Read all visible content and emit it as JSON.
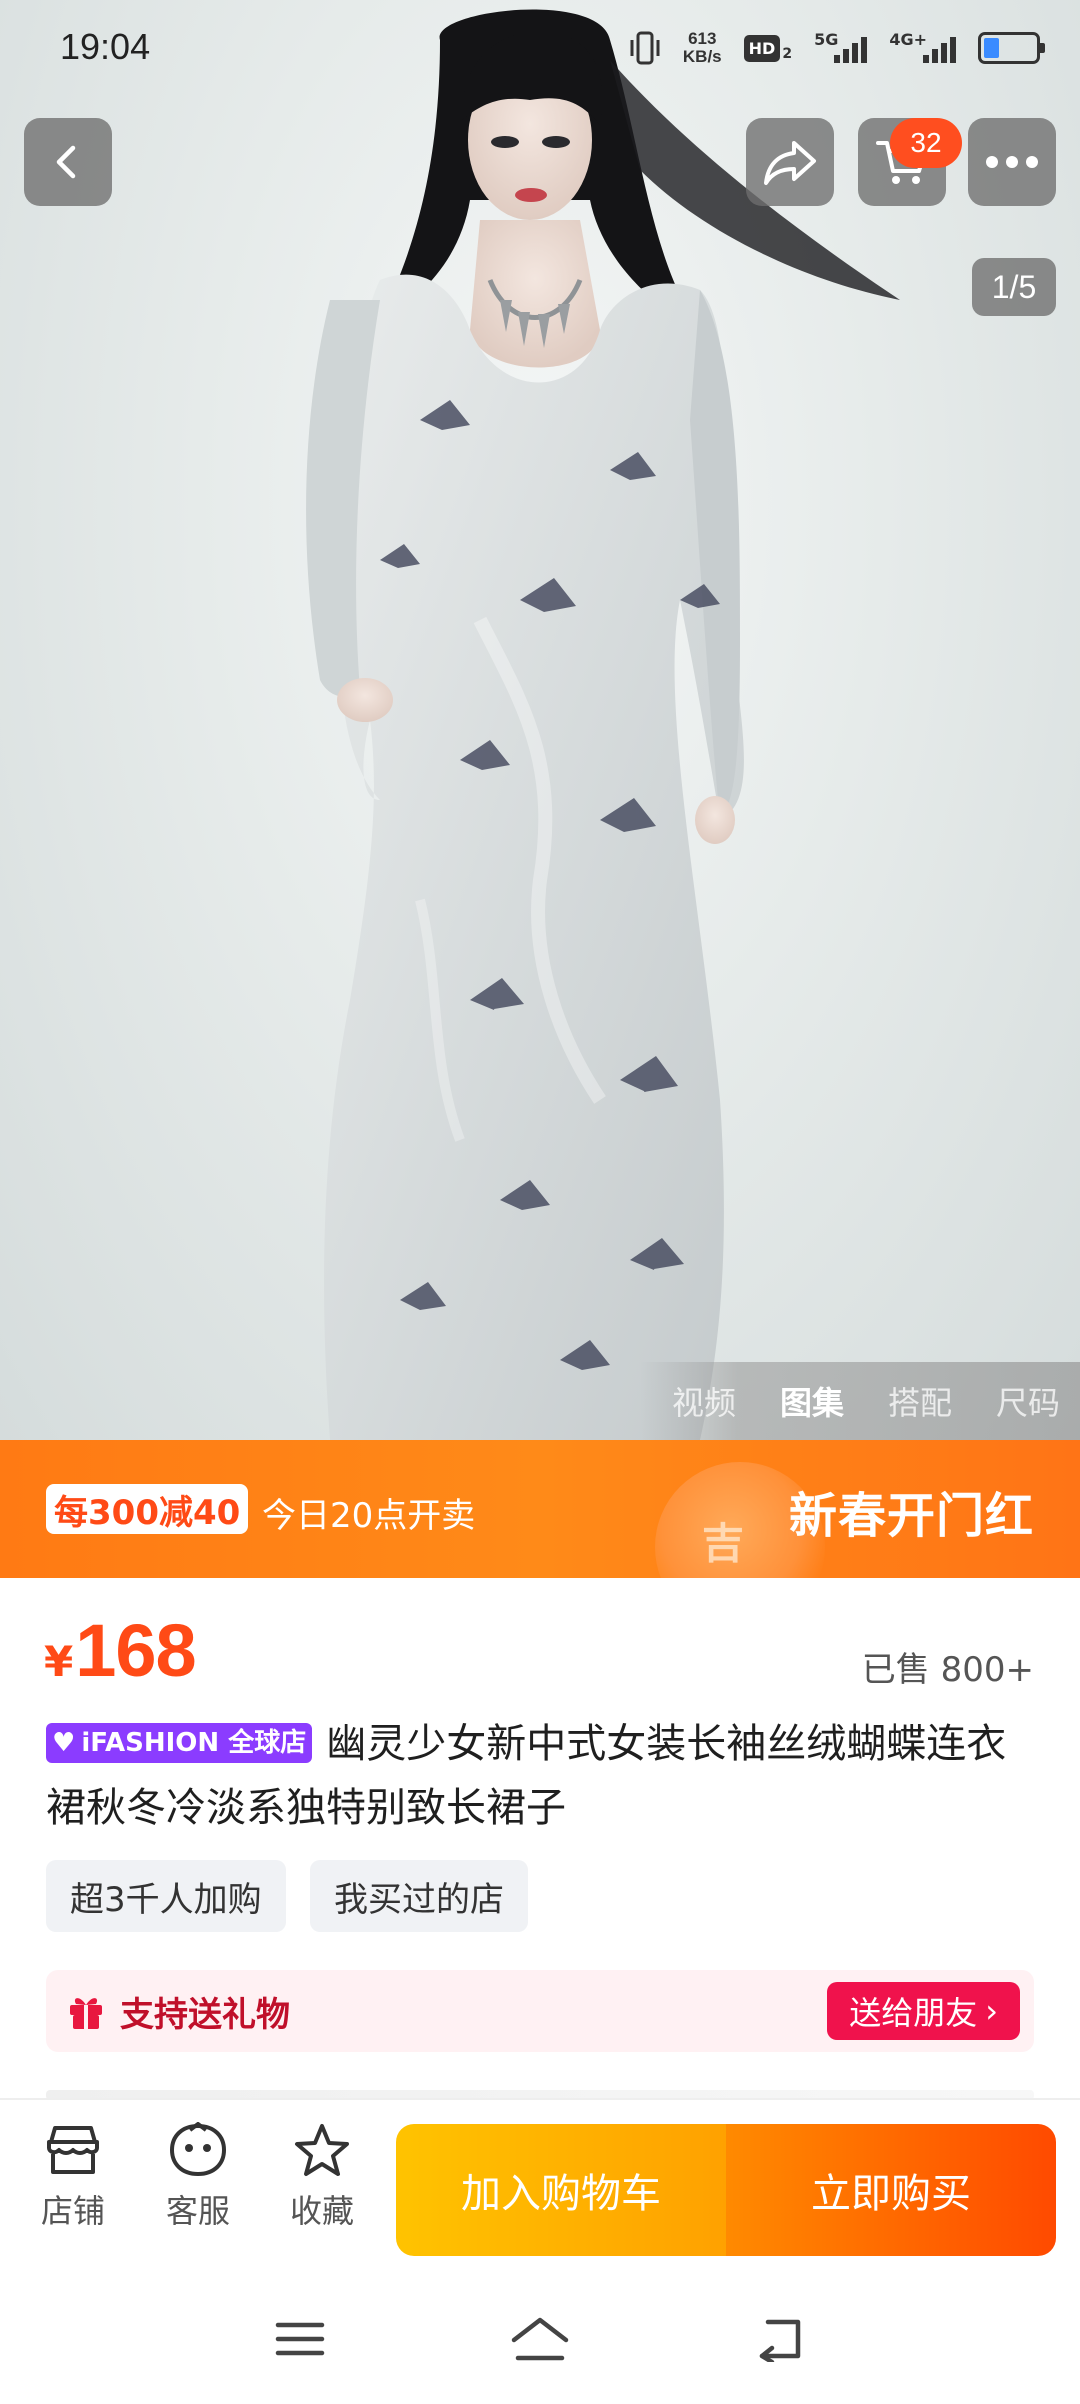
{
  "status_bar": {
    "time": "19:04",
    "net_speed_value": "613",
    "net_speed_unit": "KB/s",
    "hd_label": "HD",
    "hd_sub": "2",
    "sig1_label": "5G",
    "sig2_label": "4G+",
    "battery_level": 0.3
  },
  "top_nav": {
    "cart_badge": "32",
    "image_counter": "1/5"
  },
  "media_tabs": [
    {
      "label": "视频",
      "active": false
    },
    {
      "label": "图集",
      "active": true
    },
    {
      "label": "搭配",
      "active": false
    },
    {
      "label": "尺码",
      "active": false
    }
  ],
  "promo": {
    "tag": "每300减40",
    "subtitle": "今日20点开卖",
    "title": "新春开门红",
    "deco_char": "吉"
  },
  "product": {
    "price_currency": "¥",
    "price": "168",
    "sold": "已售 800+",
    "brand_badge": "iFASHION 全球店",
    "title": "幽灵少女新中式女装长袖丝绒蝴蝶连衣裙秋冬冷淡系独特别致长裙子",
    "chips": [
      "超3千人加购",
      "我买过的店"
    ]
  },
  "gift": {
    "text": "支持送礼物",
    "button": "送给朋友",
    "button_arrow": "›"
  },
  "action_bar": {
    "shop": "店铺",
    "service": "客服",
    "favorite": "收藏",
    "add_to_cart": "加入购物车",
    "buy_now": "立即购买"
  },
  "colors": {
    "accent": "#ff4a16",
    "promo_bg": "#ff7a14",
    "gift_red": "#f0124c",
    "brand_purple": "#8b3cff",
    "cart_yellow": "#ffb300",
    "buy_orange": "#ff5a00"
  },
  "icons": {
    "back": "chevron-left-icon",
    "share": "share-arrow-icon",
    "cart": "shopping-cart-icon",
    "more": "more-dots-icon",
    "gift": "gift-box-icon",
    "shop": "store-icon",
    "service": "chat-face-icon",
    "favorite": "star-icon",
    "nav_menu": "menu-lines-icon",
    "nav_home": "home-icon",
    "nav_back": "return-icon"
  }
}
